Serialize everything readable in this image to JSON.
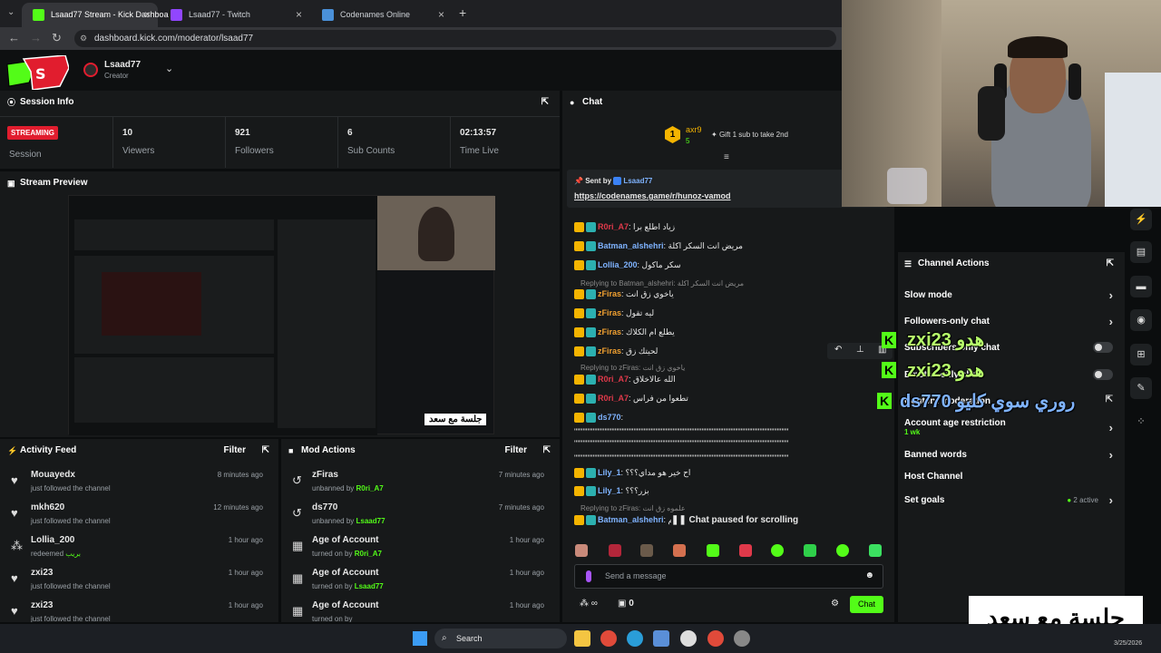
{
  "browser": {
    "tabs": [
      {
        "title": "Lsaad77 Stream - Kick Dashboa",
        "active": true
      },
      {
        "title": "Lsaad77 - Twitch",
        "active": false
      },
      {
        "title": "Codenames Online",
        "active": false
      }
    ],
    "new_tab": "+",
    "url": "dashboard.kick.com/moderator/lsaad77"
  },
  "header": {
    "channel_name": "Lsaad77",
    "role": "Creator"
  },
  "session": {
    "title": "Session Info",
    "status": "STREAMING",
    "status_label": "Session",
    "stats": [
      {
        "value": "10",
        "label": "Viewers"
      },
      {
        "value": "921",
        "label": "Followers"
      },
      {
        "value": "6",
        "label": "Sub Counts"
      },
      {
        "value": "02:13:57",
        "label": "Time Live"
      }
    ]
  },
  "stream_preview": {
    "title": "Stream Preview"
  },
  "activity_feed": {
    "title": "Activity Feed",
    "filter": "Filter",
    "items": [
      {
        "name": "Mouayedx",
        "sub": "just followed the channel",
        "time": "8 minutes ago",
        "icon": "heart-icon"
      },
      {
        "name": "mkh620",
        "sub": "just followed the channel",
        "time": "12 minutes ago",
        "icon": "heart-icon"
      },
      {
        "name": "Lollia_200",
        "sub": "redeemed",
        "extra": "بريب",
        "time": "1 hour ago",
        "icon": "points-icon"
      },
      {
        "name": "zxi23",
        "sub": "just followed the channel",
        "time": "1 hour ago",
        "icon": "heart-icon"
      },
      {
        "name": "zxi23",
        "sub": "just followed the channel",
        "time": "1 hour ago",
        "icon": "heart-icon"
      }
    ]
  },
  "mod_actions": {
    "title": "Mod Actions",
    "filter": "Filter",
    "items": [
      {
        "name": "zFiras",
        "action": "unbanned by",
        "by": "R0ri_A7",
        "time": "7 minutes ago",
        "icon": "undo-icon"
      },
      {
        "name": "ds770",
        "action": "unbanned by",
        "by": "Lsaad77",
        "time": "7 minutes ago",
        "icon": "undo-icon"
      },
      {
        "name": "Age of Account",
        "action": "turned on by",
        "by": "R0ri_A7",
        "time": "1 hour ago",
        "icon": "calendar-icon"
      },
      {
        "name": "Age of Account",
        "action": "turned on by",
        "by": "Lsaad77",
        "time": "1 hour ago",
        "icon": "calendar-icon"
      },
      {
        "name": "Age of Account",
        "action": "turned on by",
        "by": "",
        "time": "1 hour ago",
        "icon": "calendar-icon"
      }
    ]
  },
  "chat": {
    "title": "Chat",
    "top_gifter": {
      "name": "axr9",
      "count": "5",
      "rank": "1",
      "gift_text": "Gift 1 sub to take 2nd"
    },
    "pinned": {
      "sent_by": "Sent by",
      "sender": "Lsaad77",
      "link": "https://codenames.game/r/hunoz-vamod"
    },
    "messages": [
      {
        "user": "R0ri_A7",
        "color": "#e0394a",
        "text": "زياد اطلع برا"
      },
      {
        "user": "Batman_alshehri",
        "color": "#7fb3ff",
        "text": "مريض انت السكر اكلة"
      },
      {
        "user": "Lollia_200",
        "color": "#7fb3ff",
        "text": "سكر ماكول"
      },
      {
        "reply": "Replying to Batman_alshehri: مريض انت السكر اكلة"
      },
      {
        "user": "zFiras",
        "color": "#f0a030",
        "text": "ياخوي زق انت"
      },
      {
        "user": "zFiras",
        "color": "#f0a030",
        "text": "ليه تقول"
      },
      {
        "user": "zFiras",
        "color": "#f0a030",
        "text": "يطلع ام الكلاك"
      },
      {
        "user": "zFiras",
        "color": "#f0a030",
        "text": "لحيتك زق"
      },
      {
        "reply": "Replying to zFiras: ياخوي زق انت"
      },
      {
        "user": "R0ri_A7",
        "color": "#e0394a",
        "text": "الله عالاخلاق"
      },
      {
        "user": "R0ri_A7",
        "color": "#e0394a",
        "text": "تطعوا من فراس"
      },
      {
        "user": "ds770",
        "color": "#7fb3ff",
        "text": ""
      },
      {
        "user": "Lily_1",
        "color": "#7fb3ff",
        "text": "اح خير هو مداي؟؟؟"
      },
      {
        "user": "Lily_1",
        "color": "#7fb3ff",
        "text": "بزر؟؟؟"
      },
      {
        "reply": "Replying to zFiras: علموه زق انت"
      },
      {
        "user": "Batman_alshehri",
        "color": "#7fb3ff",
        "text": "خم"
      }
    ],
    "spam_line": "\"\"\"\"\"\"\"\"\"\"\"\"\"\"\"\"\"\"\"\"\"\"\"\"\"\"\"\"\"\"\"\"\"\"\"\"\"\"\"\"\"\"\"\"\"\"\"\"\"\"\"\"\"\"\"\"\"\"\"\"\"\"\"\"\"\"\"\"\"\"\"\"\"\"",
    "paused": "Chat paused for scrolling",
    "input_placeholder": "Send a message",
    "infinity": "∞",
    "gift_count": "0",
    "send_label": "Chat"
  },
  "channel_actions": {
    "title": "Channel Actions",
    "rows": [
      {
        "label": "Slow mode",
        "control": "chevron"
      },
      {
        "label": "Followers-only chat",
        "control": "chevron"
      },
      {
        "label": "Subscribers-only chat",
        "control": "toggle"
      },
      {
        "label": "Emotes-only chat",
        "control": "toggle"
      },
      {
        "label": "Content moderation",
        "control": "link"
      },
      {
        "label": "Account age restriction",
        "sub": "1 wk",
        "control": "chevron"
      },
      {
        "label": "Banned words",
        "control": "chevron"
      },
      {
        "label": "Host Channel",
        "control": "none"
      },
      {
        "label": "Set goals",
        "status": "2 active",
        "control": "chevron"
      }
    ]
  },
  "overlay": {
    "lines": [
      {
        "text": "zxi23 هدو"
      },
      {
        "text": "zxi23 هدو"
      },
      {
        "text": "ds770 روري سوي كليو"
      }
    ],
    "caption": "جلسة مع سعد"
  },
  "preview_caption": "جلسة مع سعد",
  "taskbar": {
    "search": "Search",
    "date": "3/25/2026"
  }
}
